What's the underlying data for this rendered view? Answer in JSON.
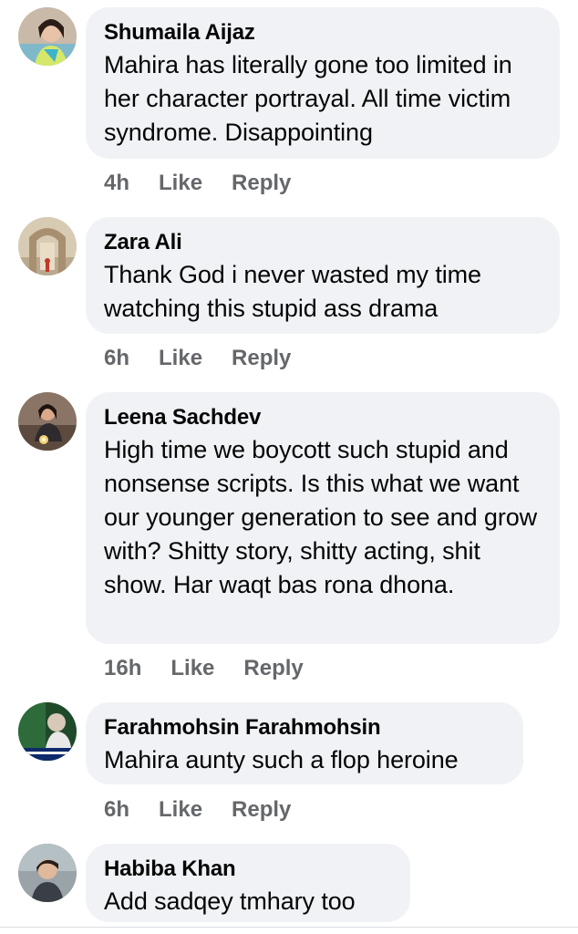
{
  "comments": [
    {
      "author": "Shumaila Aijaz",
      "text": "Mahira has literally gone too limited in her character portrayal. All time victim syndrome. Disappointing",
      "time": "4h",
      "like_label": "Like",
      "reply_label": "Reply"
    },
    {
      "author": "Zara Ali",
      "text": "Thank God i never wasted my time watching this stupid ass drama",
      "time": "6h",
      "like_label": "Like",
      "reply_label": "Reply"
    },
    {
      "author": "Leena Sachdev",
      "text": "High time we boycott such stupid and nonsense scripts. Is this what we want our younger generation to see and grow with? Shitty story, shitty acting, shit show. Har waqt bas rona dhona.",
      "time": "16h",
      "like_label": "Like",
      "reply_label": "Reply"
    },
    {
      "author": "Farahmohsin Farahmohsin",
      "text": "Mahira aunty such a flop heroine",
      "time": "6h",
      "like_label": "Like",
      "reply_label": "Reply"
    },
    {
      "author": "Habiba Khan",
      "text": "Add sadqey tmhary too",
      "time": "",
      "like_label": "",
      "reply_label": ""
    }
  ],
  "colors": {
    "bubble": "#f0f2f5",
    "name": "#050505",
    "meta": "#65676b"
  }
}
